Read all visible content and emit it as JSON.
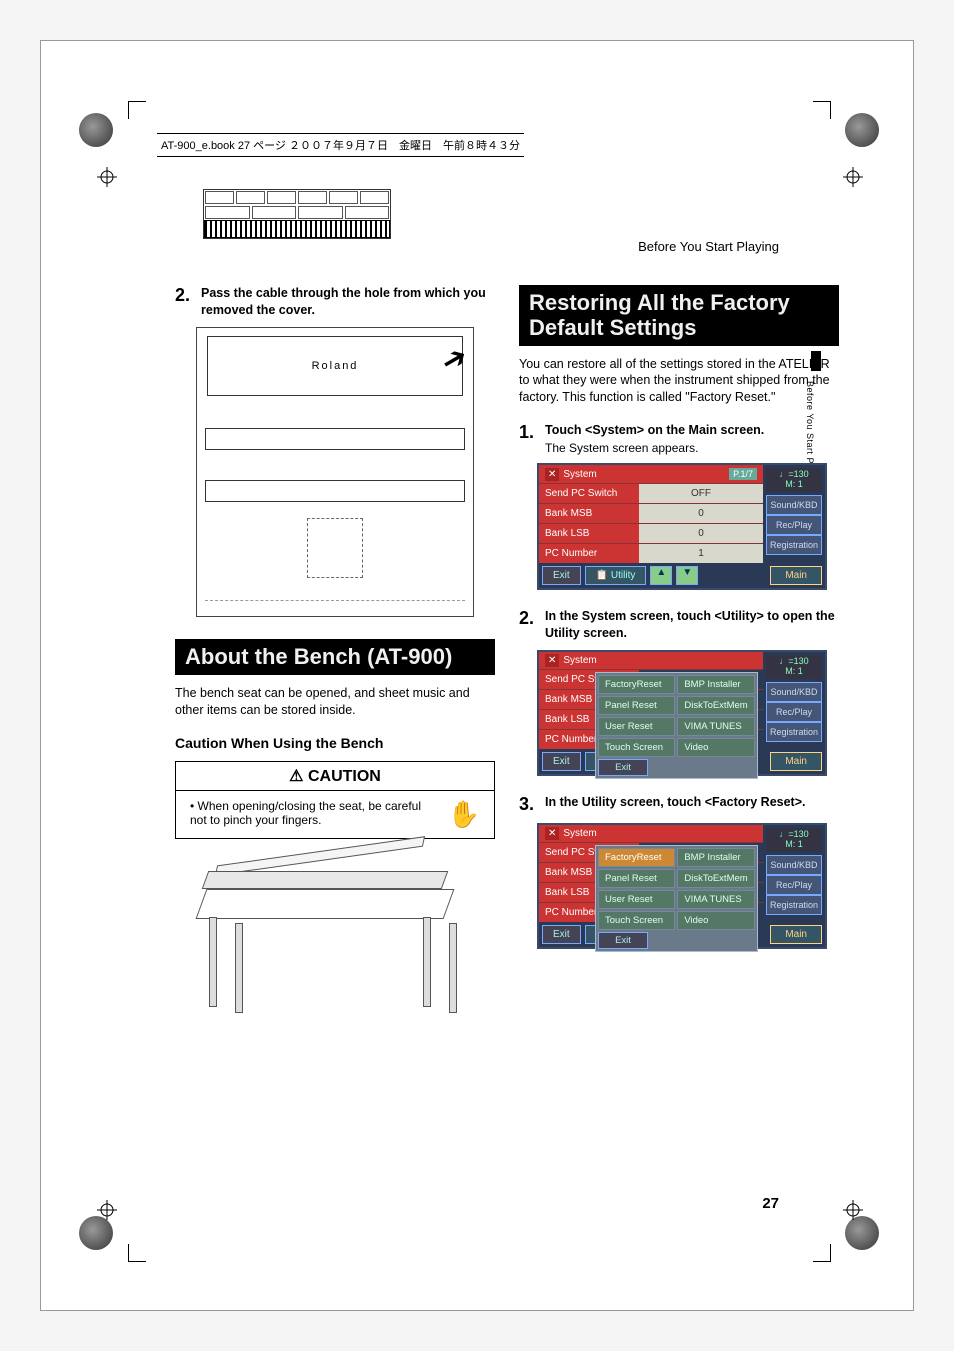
{
  "print_header": "AT-900_e.book  27 ページ  ２００７年９月７日　金曜日　午前８時４３分",
  "running_head": "Before You Start Playing",
  "side_tab_label": "Before You Start Playing",
  "page_number": "27",
  "left": {
    "step2": {
      "num": "2.",
      "text": "Pass the cable through the hole from which you removed the cover."
    },
    "organ_brand": "Roland",
    "h2_bench": "About the Bench (AT-900)",
    "bench_body": "The bench seat can be opened, and sheet music and other items can be stored inside.",
    "h3_caution": "Caution When Using the Bench",
    "caution_title": "CAUTION",
    "caution_item": "When opening/closing the seat, be careful not to pinch your fingers."
  },
  "right": {
    "h2_factory": "Restoring All the Factory Default Settings",
    "intro": "You can restore all of the settings stored in the ATELIER to what they were when the instrument shipped from the factory. This function is called \"Factory Reset.\"",
    "step1": {
      "num": "1.",
      "text": "Touch <System> on the Main screen.",
      "sub": "The System screen appears."
    },
    "step2": {
      "num": "2.",
      "text": "In the System screen, touch <Utility> to open the Utility screen."
    },
    "step3": {
      "num": "3.",
      "text": "In the Utility screen, touch <Factory Reset>."
    },
    "screen_common": {
      "title": "System",
      "page_indicator": "P.1/7",
      "tempo": "♩=130",
      "measure": "M:   1",
      "rows": [
        {
          "label": "Send PC Switch",
          "value": "OFF"
        },
        {
          "label": "Bank MSB",
          "value": "0"
        },
        {
          "label": "Bank LSB",
          "value": "0"
        },
        {
          "label": "PC Number",
          "value": "1"
        }
      ],
      "side_buttons": [
        "Sound/KBD",
        "Rec/Play",
        "Registration"
      ],
      "bottom": {
        "exit": "Exit",
        "utility": "Utility",
        "up": "▲",
        "down": "▼",
        "main": "Main"
      }
    },
    "utility_menu": {
      "items": [
        {
          "label": "FactoryReset",
          "hl": false
        },
        {
          "label": "BMP Installer",
          "hl": false
        },
        {
          "label": "Panel Reset",
          "hl": false
        },
        {
          "label": "DiskToExtMem",
          "hl": false
        },
        {
          "label": "User Reset",
          "hl": false
        },
        {
          "label": "VIMA TUNES",
          "hl": false
        },
        {
          "label": "Touch Screen",
          "hl": false
        },
        {
          "label": "Video",
          "hl": false
        }
      ],
      "exit": "Exit"
    },
    "utility_menu_hl": {
      "items": [
        {
          "label": "FactoryReset",
          "hl": true
        },
        {
          "label": "BMP Installer",
          "hl": false
        },
        {
          "label": "Panel Reset",
          "hl": false
        },
        {
          "label": "DiskToExtMem",
          "hl": false
        },
        {
          "label": "User Reset",
          "hl": false
        },
        {
          "label": "VIMA TUNES",
          "hl": false
        },
        {
          "label": "Touch Screen",
          "hl": false
        },
        {
          "label": "Video",
          "hl": false
        }
      ],
      "exit": "Exit"
    }
  }
}
